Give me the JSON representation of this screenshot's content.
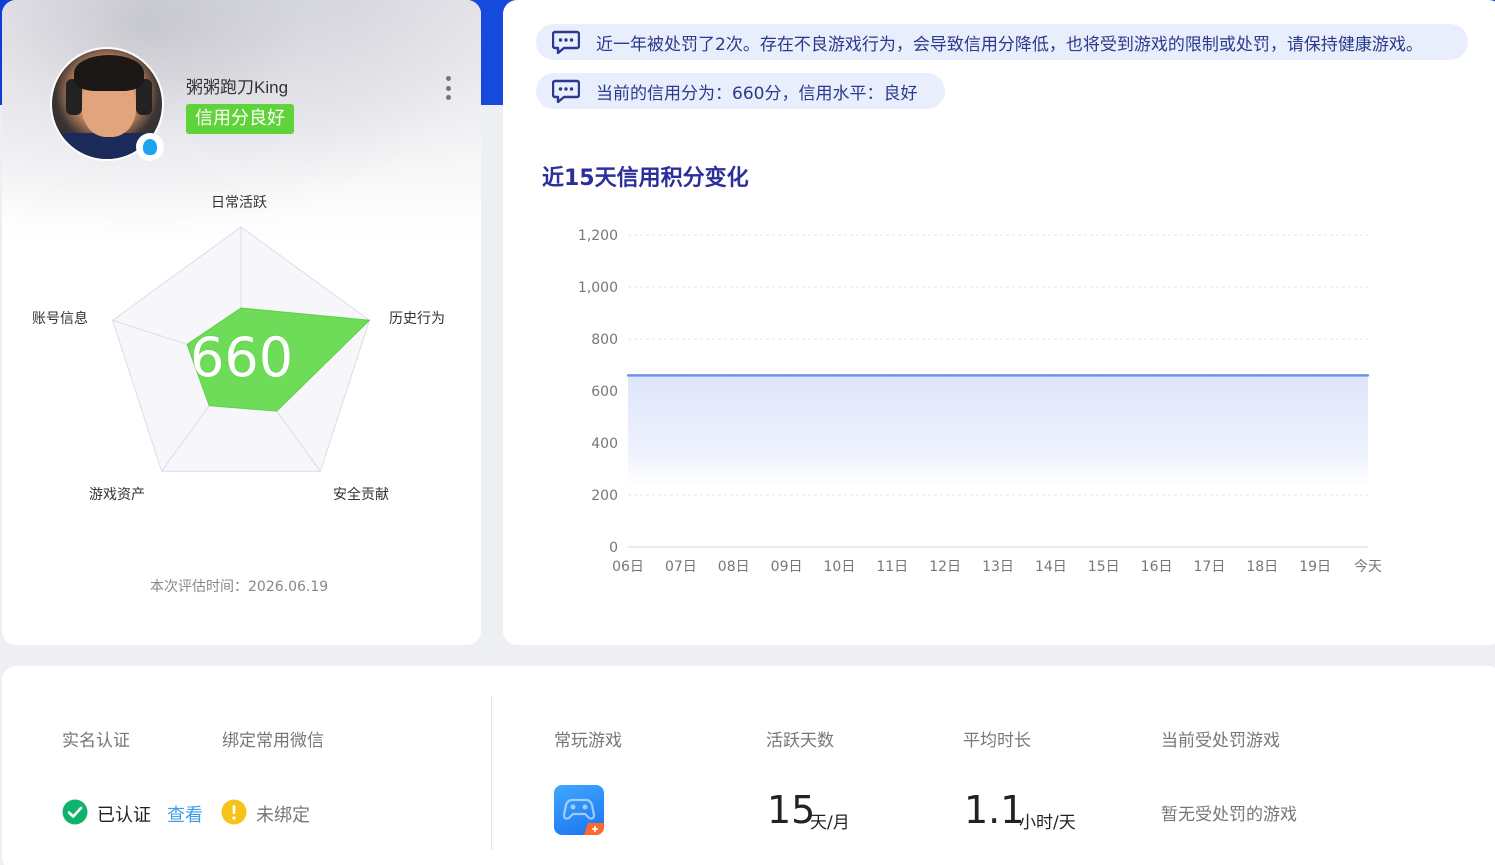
{
  "profile": {
    "username": "粥粥跑刀King",
    "credit_tag": "信用分良好",
    "score": "660",
    "eval_time": "本次评估时间：2026.06.19"
  },
  "radar": {
    "axes": [
      "日常活跃",
      "历史行为",
      "安全贡献",
      "游戏资产",
      "账号信息"
    ],
    "values": [
      0.4,
      1.0,
      0.45,
      0.4,
      0.42
    ]
  },
  "notices": [
    "近一年被处罚了2次。存在不良游戏行为，会导致信用分降低，也将受到游戏的限制或处罚，请保持健康游戏。",
    "当前的信用分为：660分，信用水平：良好"
  ],
  "chart_data": {
    "type": "area",
    "title": "近15天信用积分变化",
    "categories": [
      "06日",
      "07日",
      "08日",
      "09日",
      "10日",
      "11日",
      "12日",
      "13日",
      "14日",
      "15日",
      "16日",
      "17日",
      "18日",
      "19日",
      "今天"
    ],
    "series": [
      {
        "values": [
          660,
          660,
          660,
          660,
          660,
          660,
          660,
          660,
          660,
          660,
          660,
          660,
          660,
          660,
          660
        ]
      }
    ],
    "ylim": [
      0,
      1200
    ],
    "yticks": [
      0,
      200,
      400,
      600,
      800,
      1000,
      1200
    ],
    "ytick_labels": [
      "0",
      "200",
      "400",
      "600",
      "800",
      "1,000",
      "1,200"
    ],
    "grid": true,
    "line_color": "#6f96ee"
  },
  "bottom": {
    "real_name_label": "实名认证",
    "wechat_label": "绑定常用微信",
    "verified_text": "已认证",
    "view_link": "查看",
    "unbound_text": "未绑定",
    "frequent_game_label": "常玩游戏",
    "active_days_label": "活跃天数",
    "active_days_value": "15",
    "active_days_unit": "天/月",
    "avg_duration_label": "平均时长",
    "avg_duration_value": "1.1",
    "avg_duration_unit": "小时/天",
    "penalized_label": "当前受处罚游戏",
    "penalized_value": "暂无受处罚的游戏"
  },
  "colors": {
    "accent_blue": "#1a4fe0",
    "green": "#5fd33a",
    "link": "#3aa0e8",
    "title": "#2b2f9c"
  }
}
